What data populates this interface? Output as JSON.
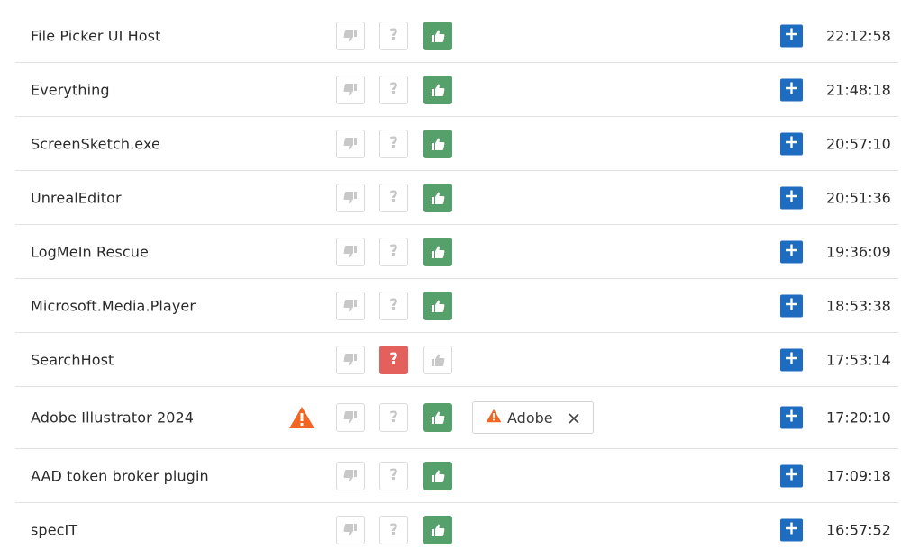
{
  "icons": {
    "thumbs_down": "thumbs-down-icon",
    "question": "question-icon",
    "thumbs_up": "thumbs-up-icon",
    "warning": "warning-icon",
    "add": "plus-icon",
    "close": "close-icon"
  },
  "colors": {
    "approve_active": "#56a06b",
    "unknown_active": "#e3605c",
    "add_button": "#1d6cc0",
    "warning": "#f26522",
    "inactive_icon": "#c8c8c8"
  },
  "question_glyph": "?",
  "rows": [
    {
      "name": "File Picker UI Host",
      "status": "approved",
      "warning": false,
      "tag": "",
      "time": "22:12:58"
    },
    {
      "name": "Everything",
      "status": "approved",
      "warning": false,
      "tag": "",
      "time": "21:48:18"
    },
    {
      "name": "ScreenSketch.exe",
      "status": "approved",
      "warning": false,
      "tag": "",
      "time": "20:57:10"
    },
    {
      "name": "UnrealEditor",
      "status": "approved",
      "warning": false,
      "tag": "",
      "time": "20:51:36"
    },
    {
      "name": "LogMeIn Rescue",
      "status": "approved",
      "warning": false,
      "tag": "",
      "time": "19:36:09"
    },
    {
      "name": "Microsoft.Media.Player",
      "status": "approved",
      "warning": false,
      "tag": "",
      "time": "18:53:38"
    },
    {
      "name": "SearchHost",
      "status": "unknown",
      "warning": false,
      "tag": "",
      "time": "17:53:14"
    },
    {
      "name": "Adobe Illustrator 2024",
      "status": "approved",
      "warning": true,
      "tag": "Adobe",
      "time": "17:20:10"
    },
    {
      "name": "AAD token broker plugin",
      "status": "approved",
      "warning": false,
      "tag": "",
      "time": "17:09:18"
    },
    {
      "name": "specIT",
      "status": "approved",
      "warning": false,
      "tag": "",
      "time": "16:57:52"
    }
  ]
}
